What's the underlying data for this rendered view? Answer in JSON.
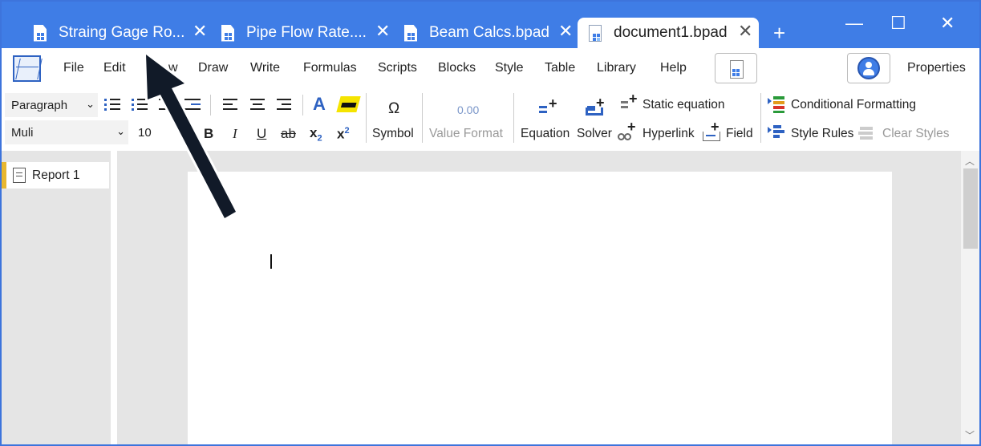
{
  "tabs": [
    {
      "label": "Straing Gage Ro...",
      "active": false
    },
    {
      "label": "Pipe Flow Rate....",
      "active": false
    },
    {
      "label": "Beam Calcs.bpad",
      "active": false
    },
    {
      "label": "document1.bpad",
      "active": true
    }
  ],
  "window": {
    "new_tab": "+",
    "minimize": "—",
    "maximize": "☐",
    "close": "✕"
  },
  "menu": {
    "items": [
      "File",
      "Edit",
      "View",
      "Draw",
      "Write",
      "Formulas",
      "Scripts",
      "Blocks",
      "Style",
      "Table",
      "Library",
      "Help"
    ],
    "visible_items": [
      "File",
      "Edit",
      "w",
      "Draw",
      "Write",
      "Formulas",
      "Scripts",
      "Blocks",
      "Style",
      "Table",
      "Library",
      "Help"
    ],
    "properties": "Properties"
  },
  "toolbar": {
    "paragraph_style": "Paragraph",
    "font": "Muli",
    "font_size": "10",
    "bold": "B",
    "italic": "I",
    "underline": "U",
    "strike": "ab",
    "subscript_base": "x",
    "subscript_mark": "2",
    "superscript_base": "x",
    "superscript_mark": "2",
    "text_color": "A",
    "symbol_glyph": "Ω",
    "symbol": "Symbol",
    "value_format_glyph": "0.00",
    "value_format": "Value Format",
    "equation": "Equation",
    "solver": "Solver",
    "static_equation": "Static equation",
    "hyperlink": "Hyperlink",
    "field": "Field",
    "conditional_formatting": "Conditional Formatting",
    "style_rules": "Style Rules",
    "clear_styles": "Clear Styles"
  },
  "sidebar": {
    "items": [
      {
        "label": "Report 1"
      }
    ]
  },
  "colors": {
    "accent": "#3f7de6",
    "highlight": "#e8b730",
    "arrow": "#111a28"
  }
}
